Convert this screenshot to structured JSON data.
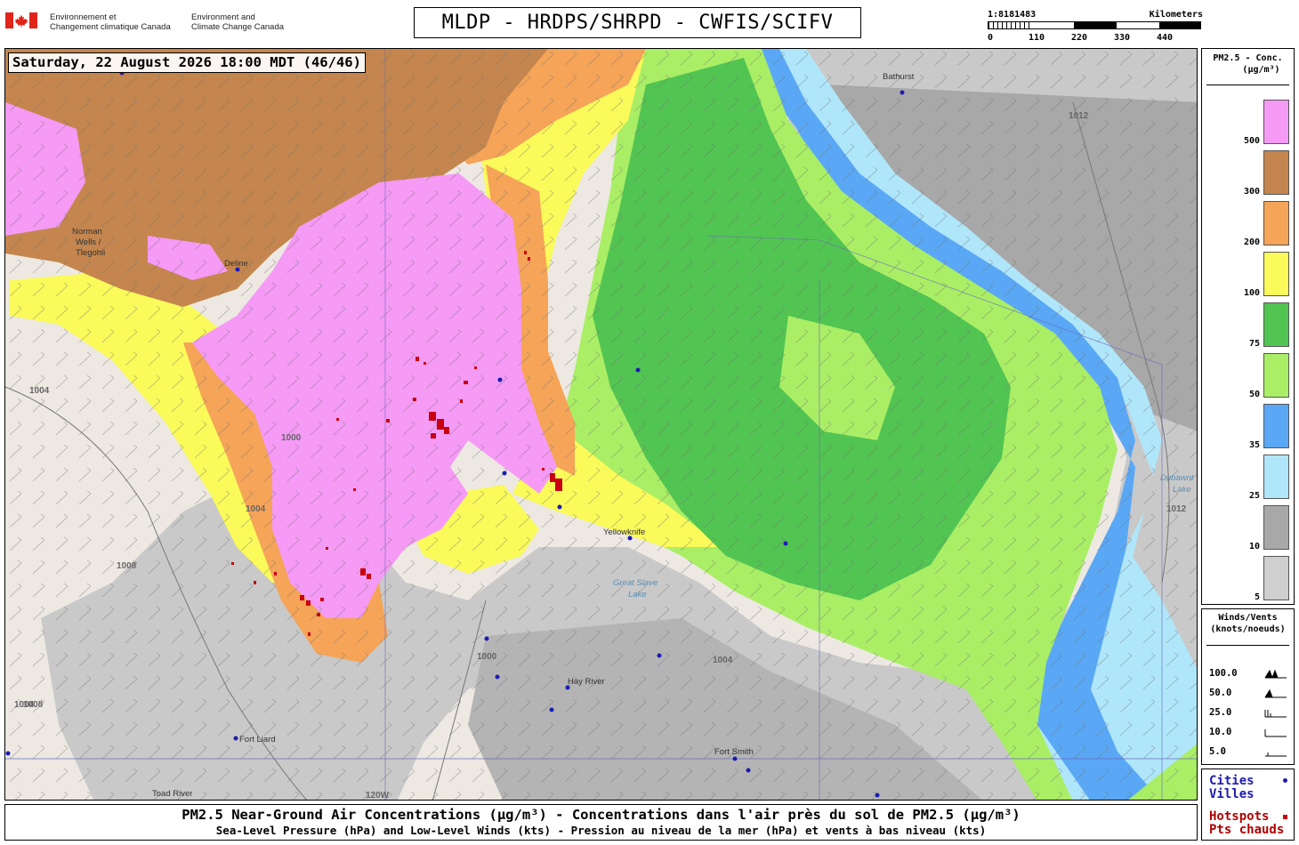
{
  "agency": {
    "french_name_line1": "Environnement et",
    "french_name_line2": "Changement climatique Canada",
    "english_name_line1": "Environment and",
    "english_name_line2": "Climate Change Canada"
  },
  "title": "MLDP - HRDPS/SHRPD - CWFIS/SCIFV",
  "scale": {
    "ratio": "1:8181483",
    "unit": "Kilometers",
    "ticks": [
      "0",
      "110",
      "220",
      "330",
      "440"
    ]
  },
  "timestamp": "Saturday, 22 August 2026 18:00 MDT (46/46)",
  "map": {
    "cities": [
      {
        "name": "Norman Wells / Tlegohli",
        "line1": "Norman",
        "line2": "Wells /",
        "line3": "Tlegohli"
      },
      {
        "name": "Deline"
      },
      {
        "name": "Yellowknife"
      },
      {
        "name": "Hay River"
      },
      {
        "name": "Fort Liard"
      },
      {
        "name": "Fort Smith"
      },
      {
        "name": "Toad River"
      },
      {
        "name": "Bathurst"
      }
    ],
    "water_bodies": [
      "Great Slave Lake",
      "Dubawnt Lake"
    ],
    "water_bodies_lines": [
      "Great Slave",
      "Lake",
      "Dubawnt",
      "Lake"
    ],
    "isobar_labels": [
      "1004",
      "1000",
      "1008",
      "1004",
      "1000",
      "1004",
      "1008",
      "1012",
      "1012",
      "1004"
    ],
    "meridian_label": "120W"
  },
  "legend": {
    "title_line1": "PM2.5 - Conc.",
    "title_line2": "(µg/m³)",
    "bins": [
      {
        "value": "500",
        "color": "#f59af5"
      },
      {
        "value": "300",
        "color": "#c4864e"
      },
      {
        "value": "200",
        "color": "#f5a458"
      },
      {
        "value": "100",
        "color": "#fafa5a"
      },
      {
        "value": "75",
        "color": "#52c452"
      },
      {
        "value": "50",
        "color": "#aaee66"
      },
      {
        "value": "35",
        "color": "#5aa8f5"
      },
      {
        "value": "25",
        "color": "#b0e6fa"
      },
      {
        "value": "10",
        "color": "#a8a8a8"
      },
      {
        "value": "5",
        "color": "#cfcfcf"
      }
    ]
  },
  "wind_legend": {
    "title_line1": "Winds/Vents",
    "title_line2": "(knots/noeuds)",
    "rows": [
      "100.0",
      "50.0",
      "25.0",
      "10.0",
      "5.0"
    ]
  },
  "markers_legend": {
    "cities_line1": "Cities",
    "cities_line2": "Villes",
    "hotspots_line1": "Hotspots",
    "hotspots_line2": "Pts chauds"
  },
  "caption": {
    "main": "PM2.5 Near-Ground Air Concentrations (µg/m³) - Concentrations dans l'air près du sol de PM2.5 (µg/m³)",
    "sub": "Sea-Level Pressure (hPa) and Low-Level Winds (kts) - Pression au niveau de la mer (hPa) et vents à bas niveau (kts)"
  },
  "colors": {
    "city_marker": "#1c1cb0",
    "hotspot_marker": "#c80010",
    "land": "#ede9e2",
    "water": "#a9d3ef"
  }
}
